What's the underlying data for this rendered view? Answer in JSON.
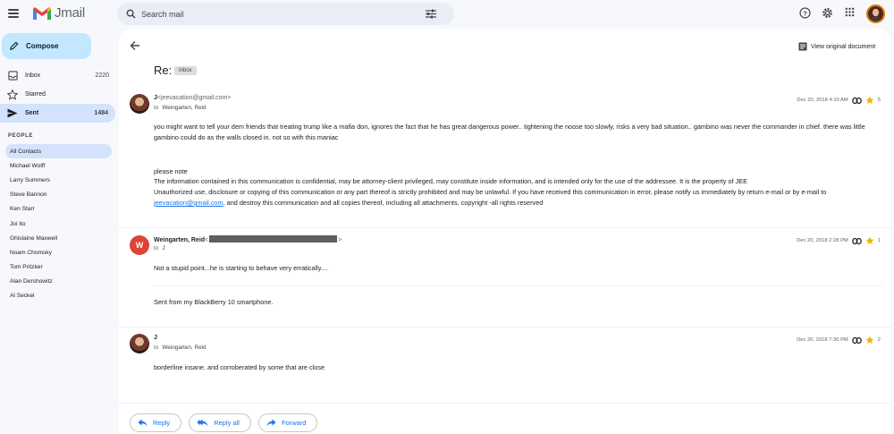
{
  "app": {
    "name": "Jmail"
  },
  "search": {
    "placeholder": "Search mail"
  },
  "sidebar": {
    "compose_label": "Compose",
    "items": [
      {
        "label": "Inbox",
        "count": "2220"
      },
      {
        "label": "Starred",
        "count": ""
      },
      {
        "label": "Sent",
        "count": "1484"
      }
    ],
    "people_header": "PEOPLE",
    "people": [
      "All Contacts",
      "Michael Wolff",
      "Larry Summers",
      "Steve Bannon",
      "Ken Starr",
      "Joi Ito",
      "Ghislaine Maxwell",
      "Noam Chomsky",
      "Tom Pritzker",
      "Alan Dershowitz",
      "Al Seckel"
    ]
  },
  "thread": {
    "view_original": "View original document",
    "subject": "Re:",
    "label": "Inbox",
    "messages": [
      {
        "sender": "J",
        "sender_addr": "<jeevacation@gmail.com>",
        "to_prefix": "to",
        "to": "Weingarten, Reid",
        "date": "Dec 20, 2018 4:10 AM",
        "star_count": "5",
        "body1": "you might want to tell your dem friends that treating trump like a mafia don, ignores the fact that he has great dangerous power.. tightening the noose too slowly, risks a very bad situation.. gambino was never the commander in chief. there was little gambino could do as the walls closed in. not so with this maniac",
        "note_title": "please note",
        "note1": "The information contained in this communication is confidential, may be attorney-client privileged, may constitute inside information, and is intended only for the use of the addressee. It is the property of JEE",
        "note2": "Unauthorized use, disclosure or copying of this communication or any part thereof is strictly prohibited and may be unlawful. If you have received this communication in error, please notify us immediately by return e-mail or by e-mail to",
        "note3_link": "jeevacation@gmail.com",
        "note3_rest": ", and destroy this communication and all copies thereof, including all attachments. copyright -all rights reserved"
      },
      {
        "sender": "Weingarten, Reid",
        "sender_addr_open": "<",
        "sender_addr_close": ">",
        "to_prefix": "to",
        "to": "J",
        "date": "Dec 20, 2018 2:28 PM",
        "star_count": "1",
        "avatar_letter": "W",
        "body1": "Not a stupid point...he is starting to behave very erratically....",
        "body2": "Sent from my BlackBerry 10 smartphone."
      },
      {
        "sender": "J",
        "to_prefix": "to",
        "to": "Weingarten, Reid",
        "date": "Dec 20, 2018 7:30 PM",
        "star_count": "2",
        "body1": "borderline insane. and corroberated by some that are close"
      }
    ],
    "actions": {
      "reply": "Reply",
      "reply_all": "Reply all",
      "forward": "Forward"
    }
  },
  "colors": {
    "accent": "#1a73e8",
    "compose_bg": "#c2e7ff",
    "active_bg": "#d3e3fd",
    "star": "#f4b400",
    "avatar_w": "#db4437"
  }
}
